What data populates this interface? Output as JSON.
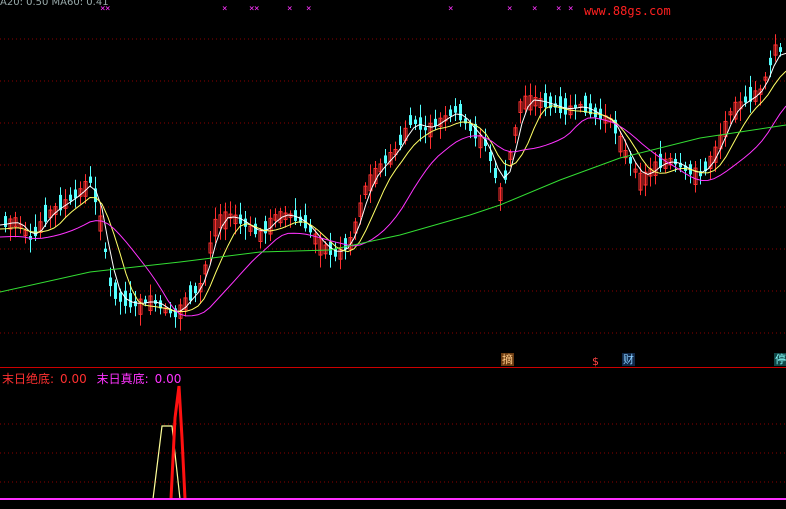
{
  "top_ma_label": "A20: 0.50  MA60: 0.41",
  "watermark": "www.88gs.com",
  "x_markers": [
    "×",
    "×",
    "×",
    "×",
    "×",
    "×",
    "×",
    "×",
    "×",
    "×",
    "×",
    "×"
  ],
  "event_tags": [
    {
      "label": "摘",
      "color": "#ffcc88",
      "bg": "#6a3a10"
    },
    {
      "label": "$",
      "color": "#ff4444",
      "bg": "transparent"
    },
    {
      "label": "财",
      "color": "#88ccff",
      "bg": "#102848"
    },
    {
      "label": "停",
      "color": "#88ffff",
      "bg": "#104848"
    }
  ],
  "indicator": {
    "label1": "末日绝底:",
    "value1": "0.00",
    "label2": "末日真底:",
    "value2": "0.00",
    "color1": "#ff3030",
    "color2": "#ff33ff"
  },
  "colors": {
    "up": "#ff3030",
    "down": "#54ffff",
    "ma_short": "#ffffff",
    "ma_mid": "#ffff66",
    "ma_long": "#ff33ff",
    "ma_vlong": "#33dd33",
    "grid": "#8b0000",
    "ind_yellow": "#ffff99",
    "ind_red": "#ff1010",
    "baseline": "#ff33ff"
  }
}
